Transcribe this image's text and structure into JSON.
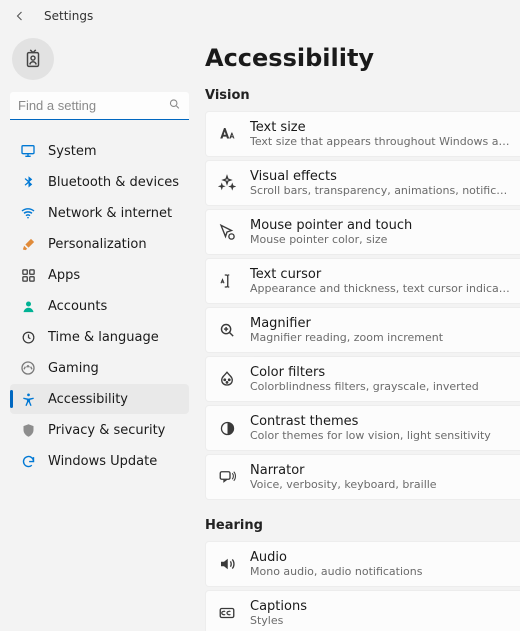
{
  "titlebar": {
    "title": "Settings"
  },
  "sidebar": {
    "search_placeholder": "Find a setting",
    "items": [
      {
        "label": "System"
      },
      {
        "label": "Bluetooth & devices"
      },
      {
        "label": "Network & internet"
      },
      {
        "label": "Personalization"
      },
      {
        "label": "Apps"
      },
      {
        "label": "Accounts"
      },
      {
        "label": "Time & language"
      },
      {
        "label": "Gaming"
      },
      {
        "label": "Accessibility"
      },
      {
        "label": "Privacy & security"
      },
      {
        "label": "Windows Update"
      }
    ]
  },
  "page": {
    "title": "Accessibility",
    "sections": [
      {
        "label": "Vision",
        "items": [
          {
            "icon": "text-size-icon",
            "title": "Text size",
            "sub": "Text size that appears throughout Windows and your apps"
          },
          {
            "icon": "visual-effects-icon",
            "title": "Visual effects",
            "sub": "Scroll bars, transparency, animations, notification timeout"
          },
          {
            "icon": "mouse-pointer-icon",
            "title": "Mouse pointer and touch",
            "sub": "Mouse pointer color, size"
          },
          {
            "icon": "text-cursor-icon",
            "title": "Text cursor",
            "sub": "Appearance and thickness, text cursor indicator"
          },
          {
            "icon": "magnifier-icon",
            "title": "Magnifier",
            "sub": "Magnifier reading, zoom increment"
          },
          {
            "icon": "color-filters-icon",
            "title": "Color filters",
            "sub": "Colorblindness filters, grayscale, inverted"
          },
          {
            "icon": "contrast-icon",
            "title": "Contrast themes",
            "sub": "Color themes for low vision, light sensitivity"
          },
          {
            "icon": "narrator-icon",
            "title": "Narrator",
            "sub": "Voice, verbosity, keyboard, braille"
          }
        ]
      },
      {
        "label": "Hearing",
        "items": [
          {
            "icon": "audio-icon",
            "title": "Audio",
            "sub": "Mono audio, audio notifications"
          },
          {
            "icon": "captions-icon",
            "title": "Captions",
            "sub": "Styles"
          }
        ]
      }
    ]
  }
}
